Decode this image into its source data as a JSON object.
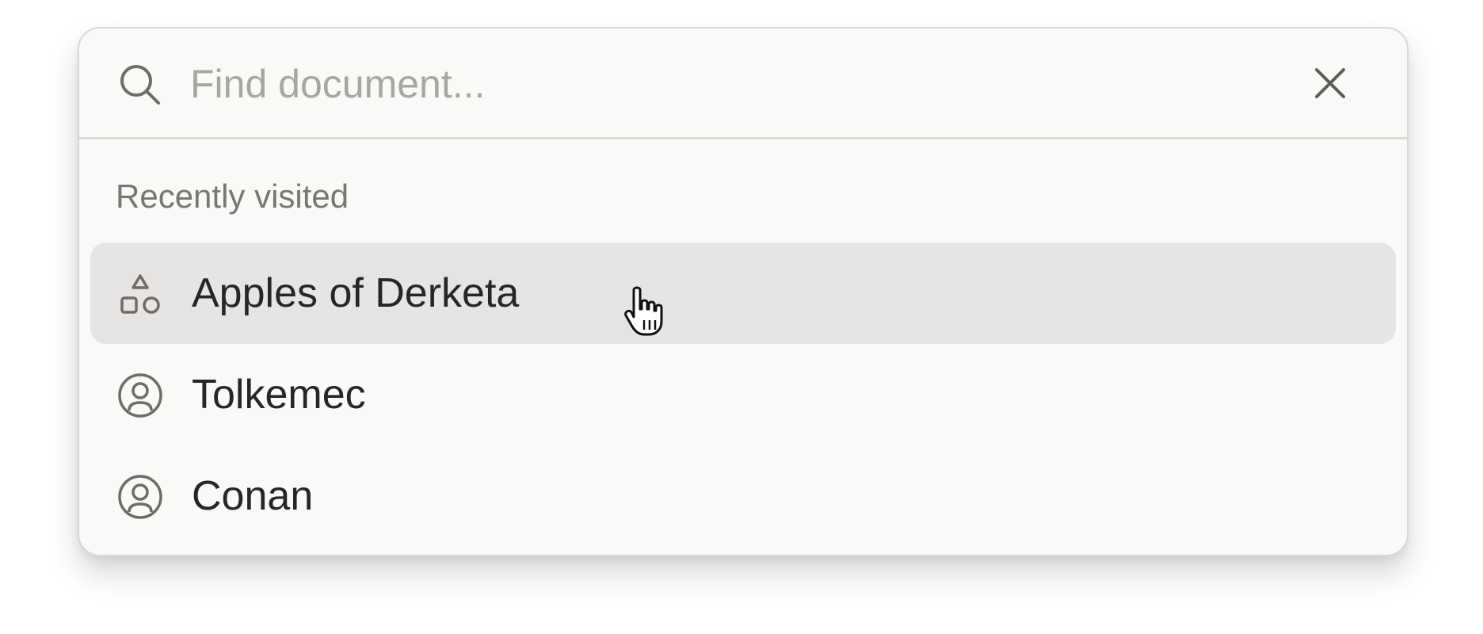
{
  "search": {
    "placeholder": "Find document...",
    "value": "",
    "icon": "search-icon",
    "clear_icon": "close-icon"
  },
  "section": {
    "label": "Recently visited"
  },
  "items": [
    {
      "label": "Apples of Derketa",
      "icon": "shapes-icon",
      "state": "hovered"
    },
    {
      "label": "Tolkemec",
      "icon": "user-circle-icon",
      "state": "default"
    },
    {
      "label": "Conan",
      "icon": "user-circle-icon",
      "state": "default"
    }
  ],
  "colors": {
    "panel_background": "#f9f9f7",
    "hover_background": "#e6e5e3",
    "text_primary": "#262626",
    "text_muted": "#7a7673",
    "placeholder": "#a8a6a3"
  }
}
